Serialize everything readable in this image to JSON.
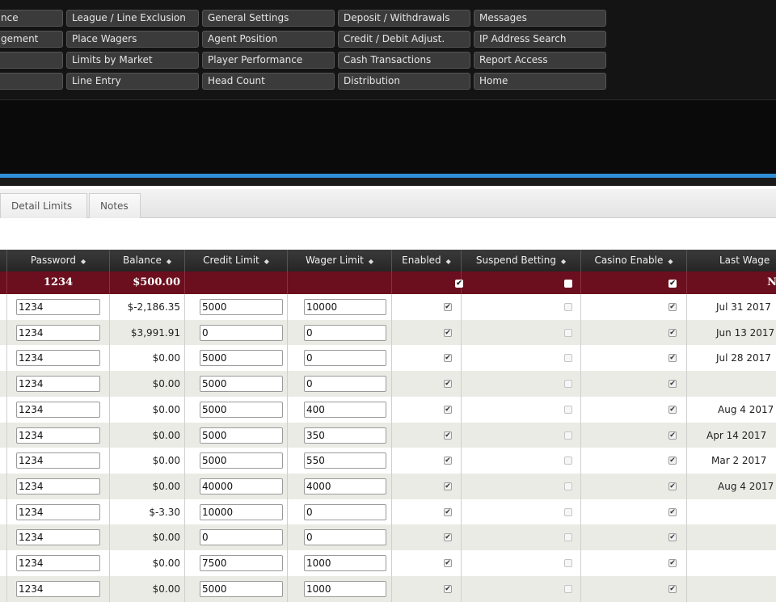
{
  "menu": [
    [
      "nce",
      "gement",
      "",
      ""
    ],
    [
      "League / Line Exclusion",
      "Place Wagers",
      "Limits by Market",
      "Line Entry"
    ],
    [
      "General Settings",
      "Agent Position",
      "Player Performance",
      "Head Count"
    ],
    [
      "Deposit / Withdrawals",
      "Credit / Debit Adjust.",
      "Cash Transactions",
      "Distribution"
    ],
    [
      "Messages",
      "IP Address Search",
      "Report Access",
      "Home"
    ]
  ],
  "tabs": [
    "Detail Limits",
    "Notes"
  ],
  "table": {
    "headers": [
      "",
      "Password",
      "Balance",
      "Credit Limit",
      "Wager Limit",
      "Enabled",
      "Suspend Betting",
      "Casino Enable",
      "Last Wage"
    ],
    "summary": {
      "password": "1234",
      "balance": "$500.00",
      "last": "N"
    },
    "rows": [
      {
        "password": "1234",
        "balance": "$-2,186.35",
        "credit": "5000",
        "wager": "10000",
        "last": "Jul 31 2017"
      },
      {
        "password": "1234",
        "balance": "$3,991.91",
        "credit": "0",
        "wager": "0",
        "last": "Jun 13 2017"
      },
      {
        "password": "1234",
        "balance": "$0.00",
        "credit": "5000",
        "wager": "0",
        "last": "Jul 28 2017"
      },
      {
        "password": "1234",
        "balance": "$0.00",
        "credit": "5000",
        "wager": "0",
        "last": ""
      },
      {
        "password": "1234",
        "balance": "$0.00",
        "credit": "5000",
        "wager": "400",
        "last": "Aug 4 2017"
      },
      {
        "password": "1234",
        "balance": "$0.00",
        "credit": "5000",
        "wager": "350",
        "last": "Apr 14 2017"
      },
      {
        "password": "1234",
        "balance": "$0.00",
        "credit": "5000",
        "wager": "550",
        "last": "Mar 2 2017"
      },
      {
        "password": "1234",
        "balance": "$0.00",
        "credit": "40000",
        "wager": "4000",
        "last": "Aug 4 2017"
      },
      {
        "password": "1234",
        "balance": "$-3.30",
        "credit": "10000",
        "wager": "0",
        "last": ""
      },
      {
        "password": "1234",
        "balance": "$0.00",
        "credit": "0",
        "wager": "0",
        "last": ""
      },
      {
        "password": "1234",
        "balance": "$0.00",
        "credit": "7500",
        "wager": "1000",
        "last": ""
      },
      {
        "password": "1234",
        "balance": "$0.00",
        "credit": "5000",
        "wager": "1000",
        "last": ""
      }
    ]
  },
  "icons": {
    "sort": "sort-arrows-icon",
    "check": "checkbox-icon"
  },
  "colors": {
    "accent": "#2f8fd8",
    "summary": "#6b0f1e",
    "header": "#2e2e2e"
  }
}
